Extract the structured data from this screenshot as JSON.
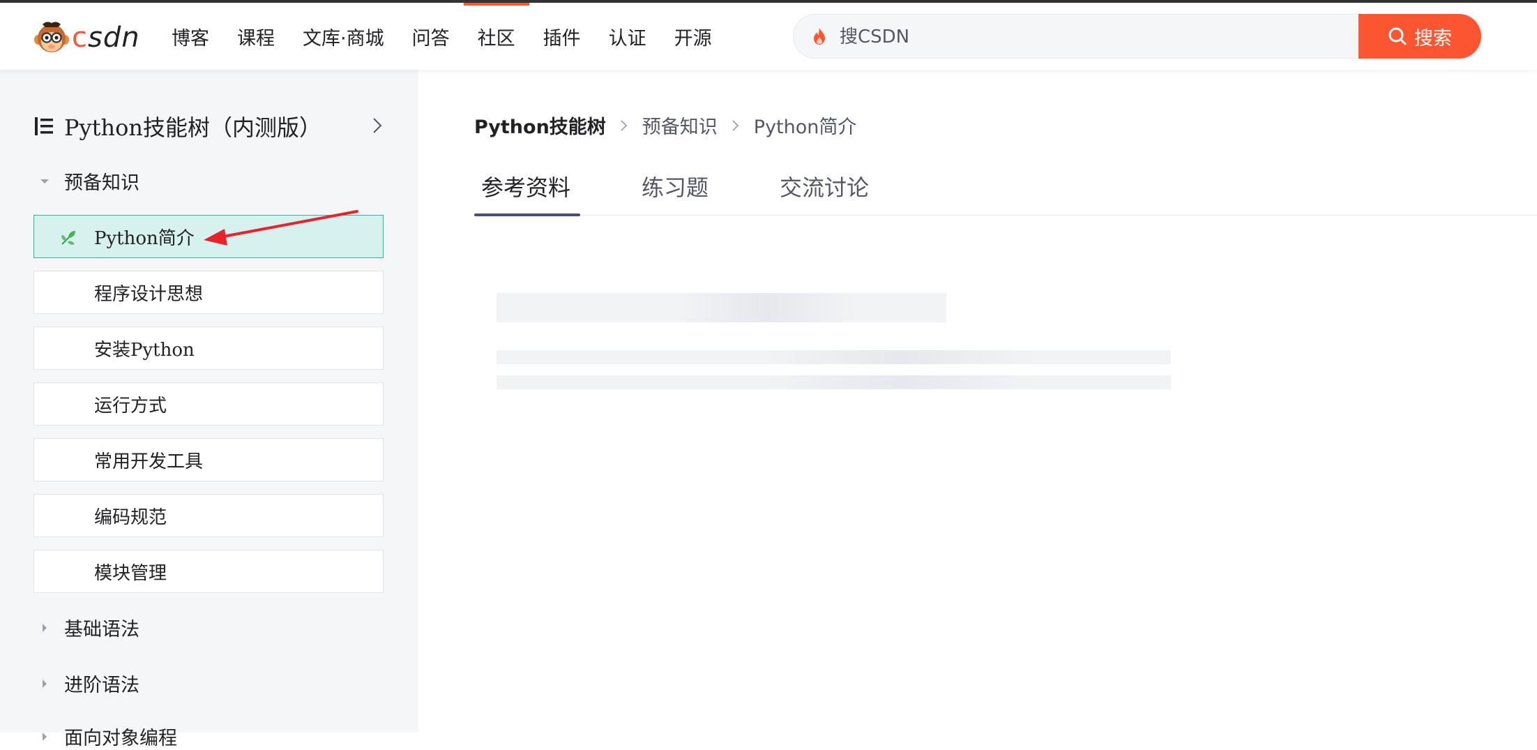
{
  "header": {
    "logo_text": "CSDN",
    "nav": [
      "博客",
      "课程",
      "文库·商城",
      "问答",
      "社区",
      "插件",
      "认证",
      "开源"
    ],
    "active_nav_index": 4,
    "search_placeholder": "搜CSDN",
    "search_button": "搜索"
  },
  "sidebar": {
    "title": "Python技能树（内测版）",
    "groups": [
      {
        "label": "预备知识",
        "expanded": true
      },
      {
        "label": "基础语法",
        "expanded": false
      },
      {
        "label": "进阶语法",
        "expanded": false
      },
      {
        "label": "面向对象编程",
        "expanded": false
      }
    ],
    "items": [
      "Python简介",
      "程序设计思想",
      "安装Python",
      "运行方式",
      "常用开发工具",
      "编码规范",
      "模块管理"
    ],
    "selected_index": 0
  },
  "breadcrumb": [
    "Python技能树",
    "预备知识",
    "Python简介"
  ],
  "tabs": [
    "参考资料",
    "练习题",
    "交流讨论"
  ],
  "active_tab_index": 0,
  "colors": {
    "brand": "#fc5531",
    "selected_bg": "#d6f1ee",
    "selected_border": "#2ab5a4",
    "annotation_arrow": "#e8222a"
  }
}
